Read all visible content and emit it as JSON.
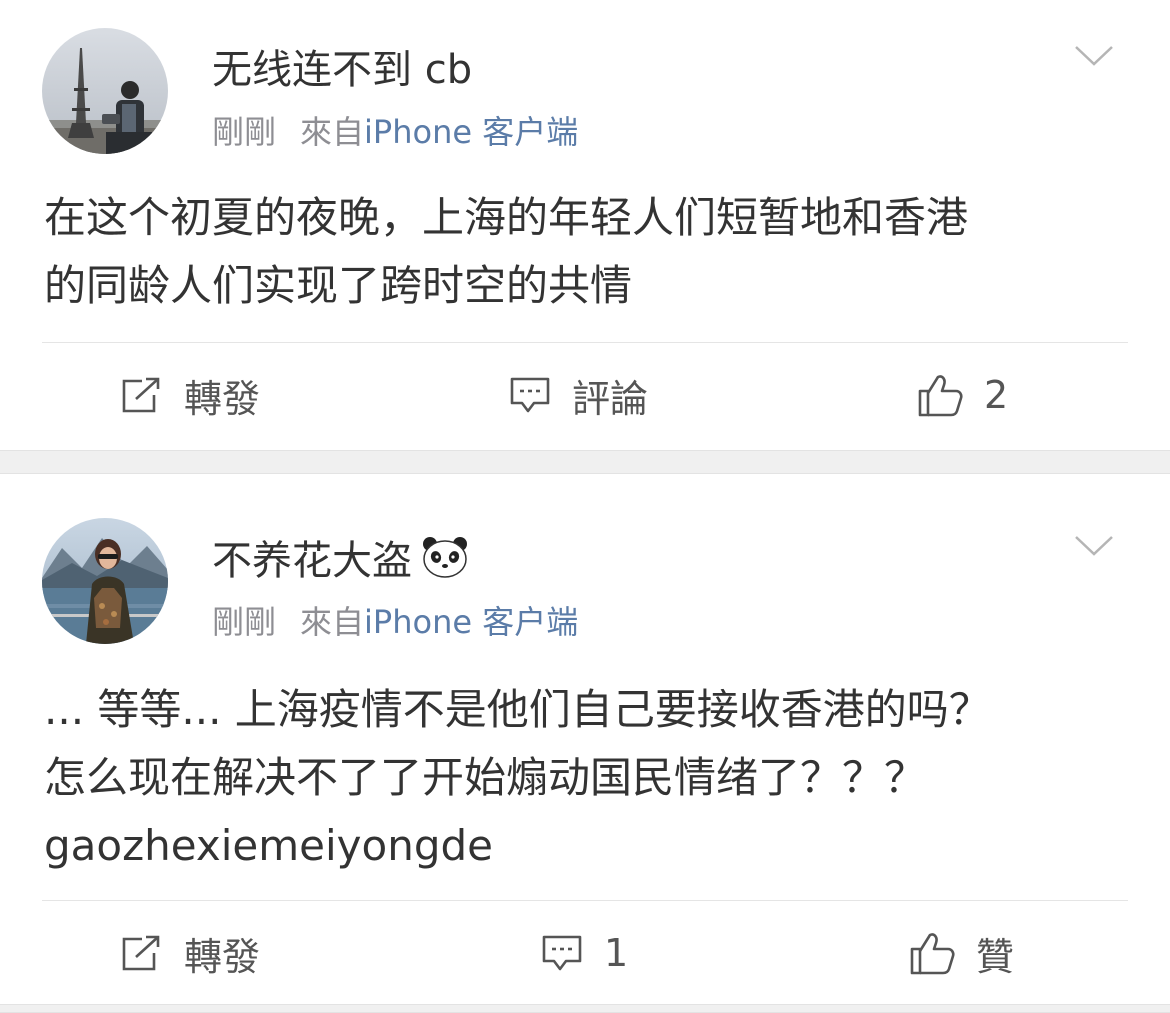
{
  "posts": [
    {
      "username": "无线连不到 cb",
      "time": "剛剛",
      "from_label": "來自",
      "source": "iPhone 客户端",
      "text_lines": [
        "在这个初夏的夜晚，上海的年轻人们短暂地和香港",
        "的同龄人们实现了跨时空的共情"
      ],
      "actions": {
        "repost": "轉發",
        "comment": "評論",
        "like": "2"
      },
      "icons": {
        "repost": "repost-icon",
        "comment": "comment-icon",
        "like": "thumbs-up-icon",
        "menu": "chevron-down-icon"
      }
    },
    {
      "username": "不养花大盗",
      "username_emoji": "panda-emoji-icon",
      "time": "剛剛",
      "from_label": "來自",
      "source": "iPhone 客户端",
      "text_lines": [
        "... 等等... 上海疫情不是他们自己要接收香港的吗？",
        "怎么现在解决不了了开始煽动国民情绪了？？？",
        "gaozhexiemeiyongde"
      ],
      "actions": {
        "repost": "轉發",
        "comment": "1",
        "like": "贊"
      },
      "icons": {
        "repost": "repost-icon",
        "comment": "comment-icon",
        "like": "thumbs-up-icon",
        "menu": "chevron-down-icon"
      }
    }
  ],
  "colors": {
    "text_primary": "#333333",
    "text_secondary": "#8e8e93",
    "source_link": "#5b7ca8",
    "divider": "#e5e5e5",
    "separator_bg": "#f0f0f0"
  }
}
